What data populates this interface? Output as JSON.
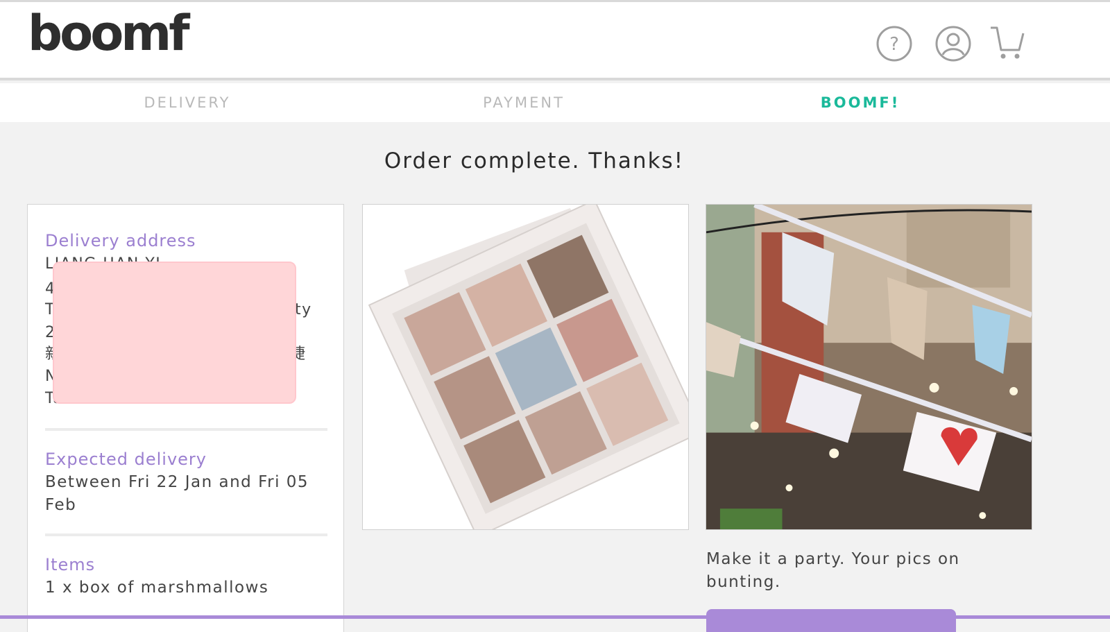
{
  "header": {
    "logo": "boomf",
    "help_icon": "help-circle-icon",
    "account_icon": "user-circle-icon",
    "cart_icon": "shopping-cart-icon"
  },
  "steps": [
    {
      "label": "DELIVERY",
      "active": false
    },
    {
      "label": "PAYMENT",
      "active": false
    },
    {
      "label": "BOOMF!",
      "active": true
    }
  ],
  "colors": {
    "accent": "#1ab99a",
    "label": "#9b7fd0",
    "button": "#a98ad8",
    "redaction": "#ffd6d8"
  },
  "main": {
    "title": "Order complete. Thanks!"
  },
  "order": {
    "delivery_label": "Delivery address",
    "address_lines": [
      "LIANG HAN YI",
      "4",
      "T",
      "2",
      "新",
      "N",
      "Taiwan"
    ],
    "address_fragments": {
      "line3_tail": "ty",
      "line5_tail": "捷"
    },
    "expected_label": "Expected delivery",
    "expected_value": "Between Fri 22 Jan and Fri 05 Feb",
    "items_label": "Items",
    "items_value": "1 x box of marshmallows"
  },
  "promo": {
    "text": "Make it a party. Your pics on bunting."
  }
}
